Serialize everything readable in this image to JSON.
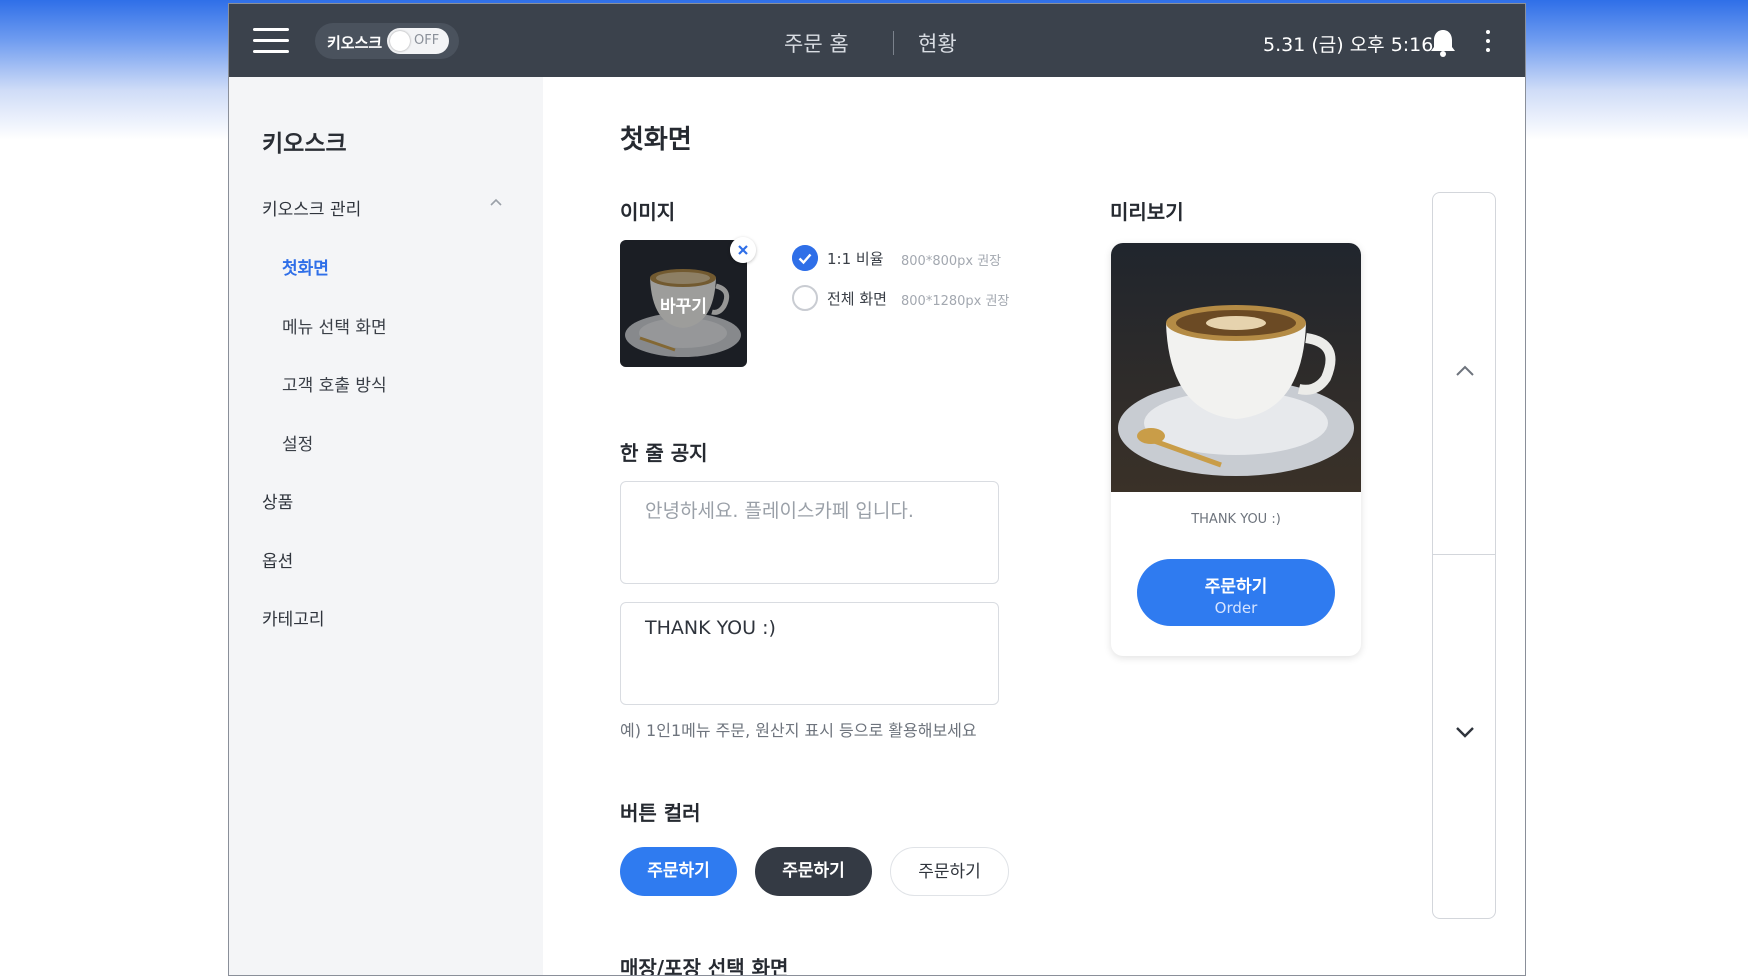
{
  "topbar": {
    "kiosk_label": "키오스크",
    "toggle_text": "OFF",
    "nav_home": "주문 홈",
    "nav_status": "현황",
    "datetime": "5.31 (금) 오후 5:16"
  },
  "sidebar": {
    "title": "키오스크",
    "group_label": "키오스크 관리",
    "sub_items": [
      {
        "label": "첫화면",
        "active": true
      },
      {
        "label": "메뉴 선택 화면",
        "active": false
      },
      {
        "label": "고객 호출 방식",
        "active": false
      },
      {
        "label": "설정",
        "active": false
      }
    ],
    "items": [
      {
        "label": "상품"
      },
      {
        "label": "옵션"
      },
      {
        "label": "카테고리"
      }
    ]
  },
  "main": {
    "page_title": "첫화면",
    "image_section": {
      "title": "이미지",
      "change_label": "바꾸기",
      "ratio_options": [
        {
          "label": "1:1 비율",
          "hint": "800*800px 권장",
          "selected": true
        },
        {
          "label": "전체 화면",
          "hint": "800*1280px 권장",
          "selected": false
        }
      ]
    },
    "notice_section": {
      "title": "한 줄 공지",
      "input1_placeholder": "안녕하세요. 플레이스카페 입니다.",
      "input2_value": "THANK YOU :)",
      "hint": "예) 1인1메뉴 주문, 원산지 표시 등으로 활용해보세요"
    },
    "button_color_section": {
      "title": "버튼 컬러",
      "options": [
        "주문하기",
        "주문하기",
        "주문하기"
      ]
    },
    "store_section_title": "매장/포장 선택 화면"
  },
  "preview": {
    "title": "미리보기",
    "notice": "THANK YOU :)",
    "order_label": "주문하기",
    "order_sub": "Order"
  },
  "colors": {
    "accent": "#2f7bf0",
    "topbar": "#3b424c",
    "dark_button": "#343a44"
  }
}
